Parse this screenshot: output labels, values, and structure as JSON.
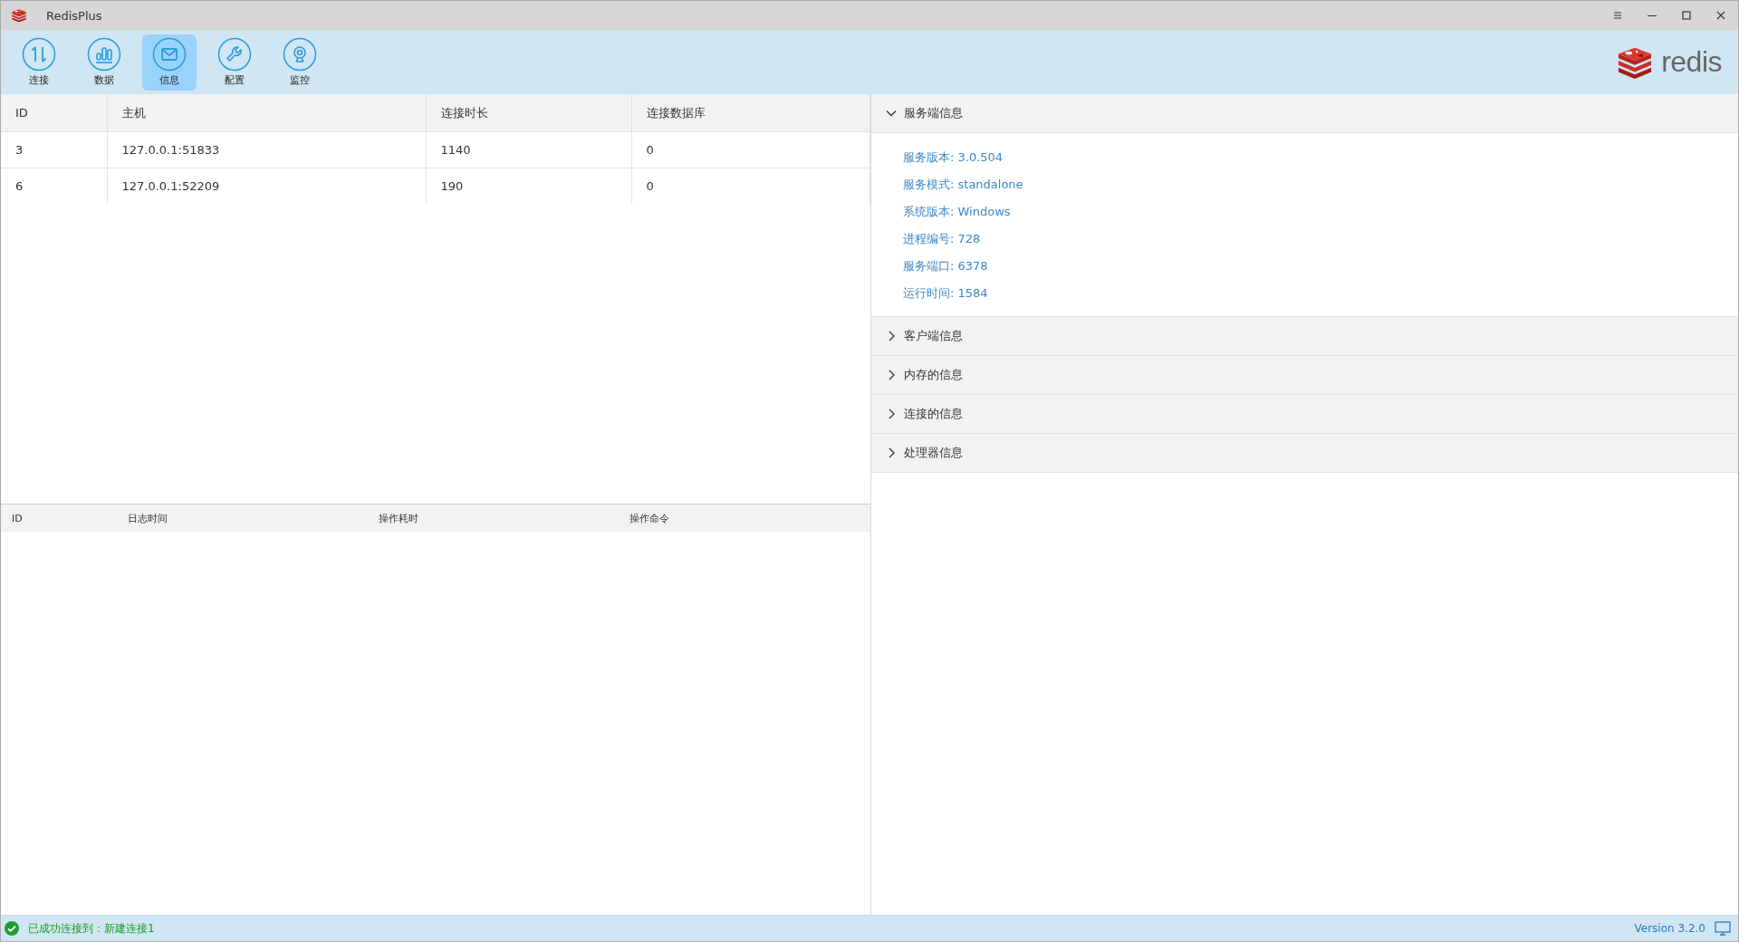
{
  "window": {
    "title": "RedisPlus"
  },
  "toolbar": [
    {
      "kind": "connect",
      "label": "连接",
      "selected": false
    },
    {
      "kind": "data",
      "label": "数据",
      "selected": false
    },
    {
      "kind": "info",
      "label": "信息",
      "selected": true
    },
    {
      "kind": "config",
      "label": "配置",
      "selected": false
    },
    {
      "kind": "monitor",
      "label": "监控",
      "selected": false
    }
  ],
  "logo": {
    "text": "redis"
  },
  "clients_table": {
    "columns": [
      "ID",
      "主机",
      "连接时长",
      "连接数据库"
    ],
    "rows": [
      [
        "3",
        "127.0.0.1:51833",
        "1140",
        "0"
      ],
      [
        "6",
        "127.0.0.1:52209",
        "190",
        "0"
      ]
    ]
  },
  "log_table": {
    "columns": [
      "ID",
      "日志时间",
      "操作耗时",
      "操作命令"
    ]
  },
  "info_sections": [
    {
      "title": "服务端信息",
      "expanded": true,
      "items": [
        "服务版本: 3.0.504",
        "服务模式: standalone",
        "系统版本: Windows",
        "进程编号: 728",
        "服务端口: 6378",
        "运行时间: 1584"
      ]
    },
    {
      "title": "客户端信息",
      "expanded": false
    },
    {
      "title": "内存的信息",
      "expanded": false
    },
    {
      "title": "连接的信息",
      "expanded": false
    },
    {
      "title": "处理器信息",
      "expanded": false
    }
  ],
  "status_bar": {
    "ok": true,
    "message": "已成功连接到：新建连接1",
    "version": "Version 3.2.0"
  }
}
